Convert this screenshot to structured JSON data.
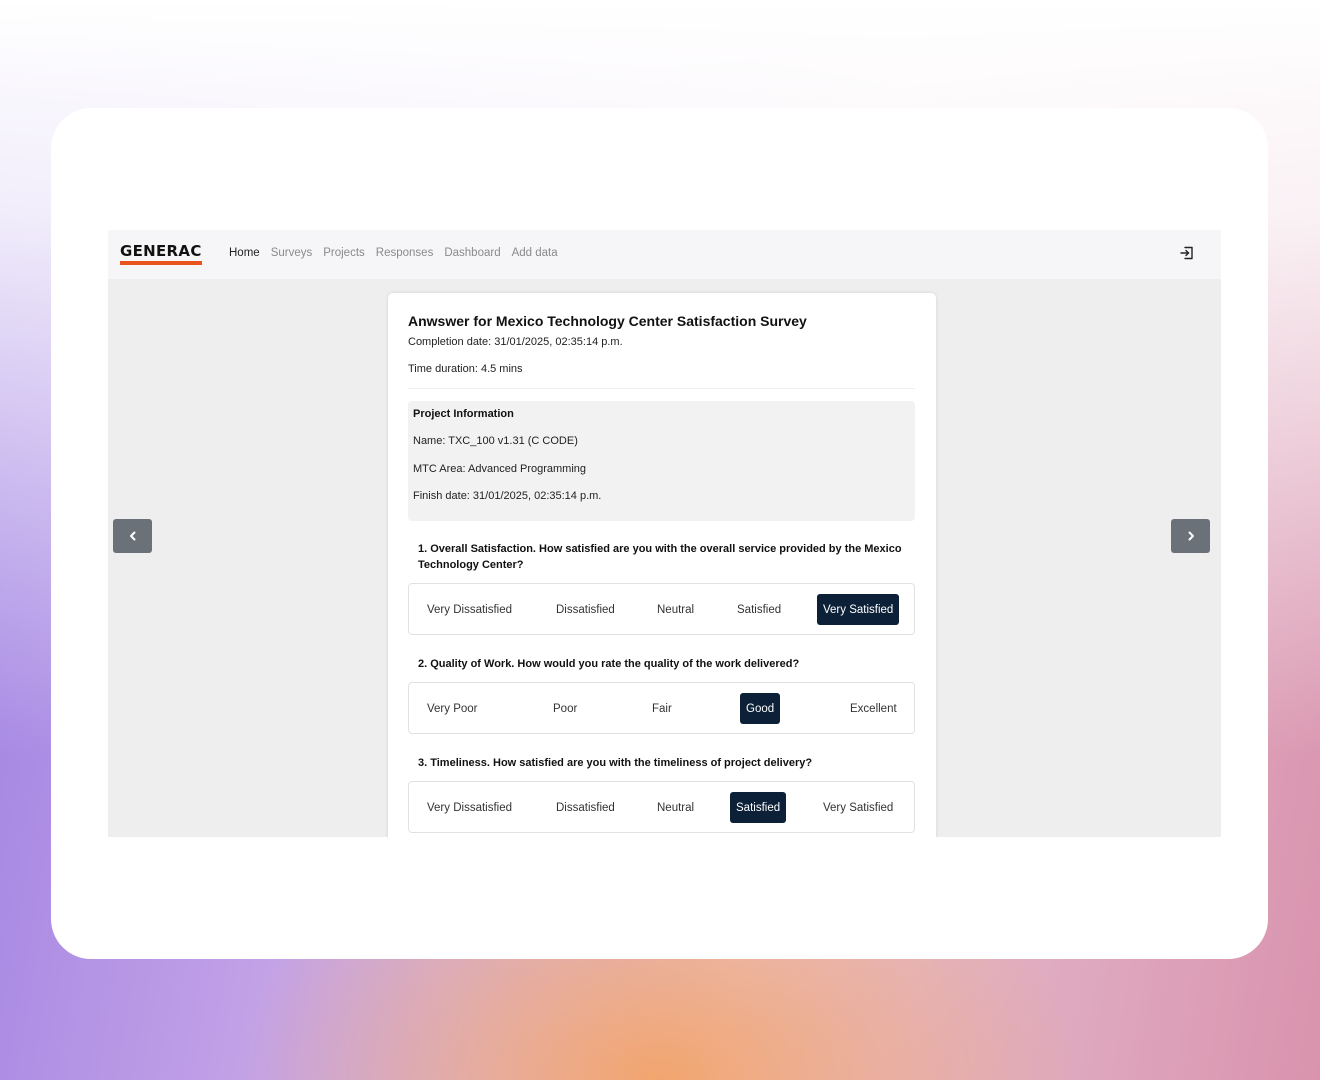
{
  "brand": {
    "logo_text": "GENERAC",
    "accent_color": "#e8541c",
    "selected_color": "#0c2138"
  },
  "nav": {
    "items": [
      "Home",
      "Surveys",
      "Projects",
      "Responses",
      "Dashboard",
      "Add data"
    ],
    "active": "Home",
    "logout_icon": "logout-icon"
  },
  "carousel": {
    "prev_icon": "chevron-left-icon",
    "next_icon": "chevron-right-icon"
  },
  "survey": {
    "title": "Anwswer for Mexico Technology Center Satisfaction Survey",
    "completion": "Completion date: 31/01/2025, 02:35:14 p.m.",
    "duration": "Time duration: 4.5 mins"
  },
  "project": {
    "heading": "Project Information",
    "name": "Name: TXC_100 v1.31 (C CODE)",
    "area": "MTC Area: Advanced Programming",
    "finish": "Finish date: 31/01/2025, 02:35:14 p.m."
  },
  "questions": [
    {
      "text": "1. Overall Satisfaction. How satisfied are you with the overall service provided by the Mexico Technology Center?",
      "options": [
        "Very Dissatisfied",
        "Dissatisfied",
        "Neutral",
        "Satisfied",
        "Very Satisfied"
      ],
      "selected": "Very Satisfied"
    },
    {
      "text": "2. Quality of Work. How would you rate the quality of the work delivered?",
      "options": [
        "Very Poor",
        "Poor",
        "Fair",
        "Good",
        "Excellent"
      ],
      "selected": "Good"
    },
    {
      "text": "3. Timeliness. How satisfied are you with the timeliness of project delivery?",
      "options": [
        "Very Dissatisfied",
        "Dissatisfied",
        "Neutral",
        "Satisfied",
        "Very Satisfied"
      ],
      "selected": "Satisfied"
    }
  ]
}
